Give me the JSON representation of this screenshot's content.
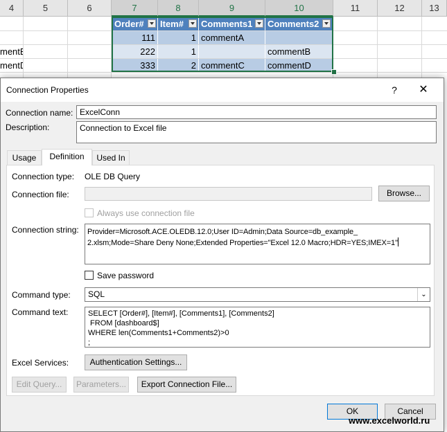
{
  "sheet": {
    "columns": [
      {
        "label": "4"
      },
      {
        "label": "5"
      },
      {
        "label": "6"
      },
      {
        "label": "7"
      },
      {
        "label": "8"
      },
      {
        "label": "9"
      },
      {
        "label": "10"
      },
      {
        "label": "11"
      },
      {
        "label": "12"
      },
      {
        "label": "13"
      }
    ],
    "table_headers": [
      "Order#",
      "Item#",
      "Comments1",
      "Comments2"
    ],
    "rows": [
      {
        "left": "",
        "order": "111",
        "item": "1",
        "c1": "commentA",
        "c2": ""
      },
      {
        "left": "mentB",
        "order": "222",
        "item": "1",
        "c1": "",
        "c2": "commentB"
      },
      {
        "left": "mentD",
        "order": "333",
        "item": "2",
        "c1": "commentC",
        "c2": "commentD"
      }
    ]
  },
  "dialog": {
    "title": "Connection Properties",
    "help_glyph": "?",
    "close_glyph": "✕",
    "connection_name_label": "Connection name:",
    "connection_name_value": "ExcelConn",
    "description_label": "Description:",
    "description_value": "Connection to Excel file",
    "tabs": [
      {
        "label": "Usage"
      },
      {
        "label": "Definition"
      },
      {
        "label": "Used In"
      }
    ],
    "connection_type_label": "Connection type:",
    "connection_type_value": "OLE DB Query",
    "connection_file_label": "Connection file:",
    "connection_file_value": "",
    "browse_label": "Browse...",
    "always_use_file_label": "Always use connection file",
    "connection_string_label": "Connection string:",
    "connection_string_line1": "Provider=Microsoft.ACE.OLEDB.12.0;User ID=Admin;Data Source=db_example_",
    "connection_string_line2": "2.xlsm;Mode=Share Deny None;Extended Properties=\"Excel 12.0 Macro;HDR=YES;IMEX=1\"",
    "save_password_label": "Save password",
    "command_type_label": "Command type:",
    "command_type_value": "SQL",
    "command_text_label": "Command text:",
    "command_text_value": "SELECT [Order#], [Item#], [Comments1], [Comments2]\n FROM [dashboard$]\nWHERE len(Comments1+Comments2)>0\n;",
    "excel_services_label": "Excel Services:",
    "auth_settings_label": "Authentication Settings...",
    "edit_query_label": "Edit Query...",
    "parameters_label": "Parameters...",
    "export_label": "Export Connection File...",
    "ok_label": "OK",
    "cancel_label": "Cancel"
  },
  "watermark": "www.excelworld.ru"
}
